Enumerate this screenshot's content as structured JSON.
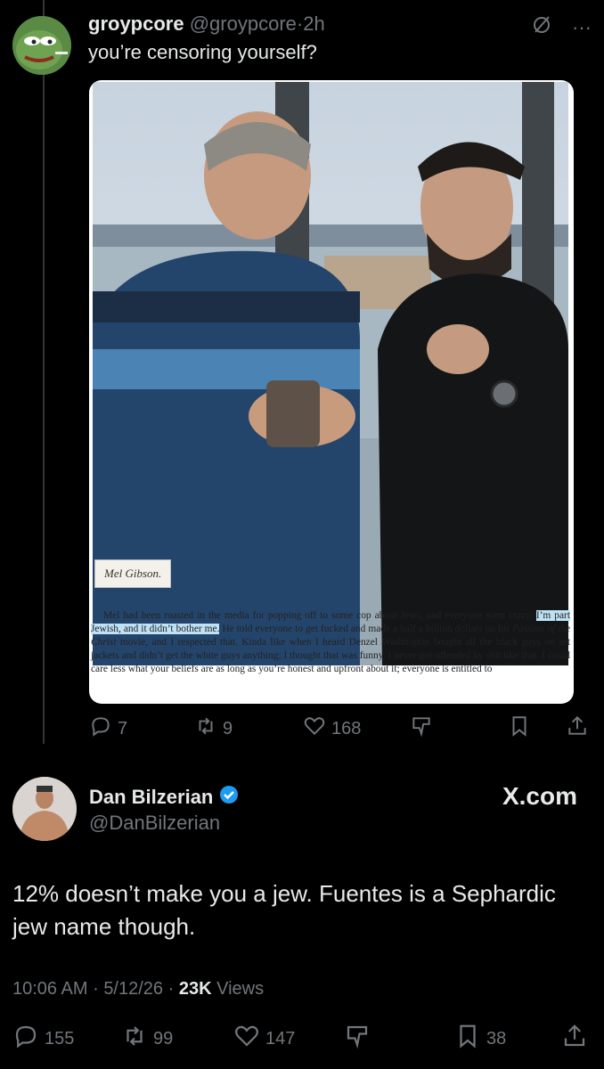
{
  "reply": {
    "name": "groypcore",
    "handle": "@groypcore",
    "sep": "·",
    "time": "2h",
    "text": "you’re censoring yourself?",
    "caption": "Mel Gibson.",
    "book_before": "Mel had been roasted in the media for popping off to some cop about Jews, and everyone went crazy.",
    "book_highlight": "I’m part Jewish, and it didn’t bother me.",
    "book_after": "He told everyone to get fucked and made a half a billion dollars on his",
    "book_title": "Passion of the Christ",
    "book_end": "movie, and I respected that. Kinda like when I heard Denzel Washington bought all the black guys on set jackets and didn’t get the white guys anything; I thought that was funny. I never got offended by shit like that. I could care less what your beliefs are as long as you’re honest and upfront about it; everyone is entitled to",
    "stats": {
      "replies": "7",
      "reposts": "9",
      "likes": "168"
    }
  },
  "main": {
    "name": "Dan Bilzerian",
    "handle": "@DanBilzerian",
    "watermark": "X.com",
    "text": "12% doesn’t make you a jew. Fuentes is a Sephardic jew name though.",
    "time": "10:06 AM",
    "date": "5/12/26",
    "views_count": "23K",
    "views_label": "Views",
    "sep": "·",
    "stats": {
      "replies": "155",
      "reposts": "99",
      "likes": "147",
      "bookmarks": "38"
    }
  },
  "colors": {
    "background": "#000000",
    "text": "#e7e9ea",
    "muted": "#71767b",
    "verified": "#1d9bf0",
    "highlight": "#bfe1f5"
  }
}
